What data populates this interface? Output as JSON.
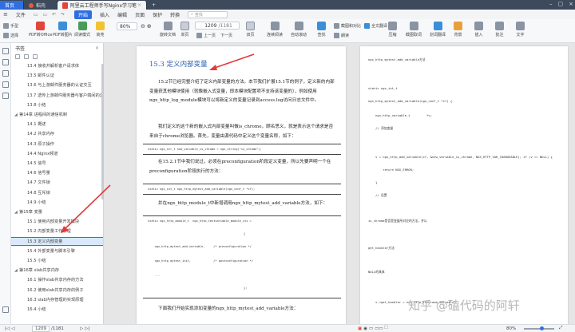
{
  "tabs": [
    {
      "label": "首页"
    },
    {
      "label": "稻壳"
    },
    {
      "label": "阿里云工程师手写Nginx学习笔记.pdf"
    }
  ],
  "menus": [
    "文件",
    "开始",
    "插入",
    "编辑",
    "页面",
    "保护",
    "转换",
    "查找"
  ],
  "toolbar": {
    "items": [
      "手型",
      "选择",
      "PDF转Office",
      "PDF转图片",
      "阅读模式",
      "高亮",
      "旋转文档",
      "单页",
      "双页",
      "连续阅读",
      "自动滚动",
      "查找",
      "截图和对比",
      "朗读",
      "全文翻译",
      "压缩",
      "截图取词",
      "划词翻译",
      "背景",
      "插入",
      "批注",
      "文字"
    ],
    "zoom": "80%",
    "page": "1209",
    "page_total": "/1181",
    "prev": "上一页",
    "next": "下一页"
  },
  "sidebar": {
    "title": "书签",
    "items": [
      {
        "label": "13.4 接收并解析客户请求体",
        "level": 2
      },
      {
        "label": "13.5 邮件认证",
        "level": 2
      },
      {
        "label": "13.6 与上游邮件服务器的认证交互",
        "level": 2
      },
      {
        "label": "13.7 透传上游邮件服务器与客户端间的流",
        "level": 2
      },
      {
        "label": "13.8 小结",
        "level": 2
      },
      {
        "label": "第14章 进程间的通信机制",
        "level": 1
      },
      {
        "label": "14.1 概述",
        "level": 2
      },
      {
        "label": "14.2 共享内存",
        "level": 2
      },
      {
        "label": "14.3 原子操作",
        "level": 2
      },
      {
        "label": "14.4 Nginx频道",
        "level": 2
      },
      {
        "label": "14.5 信号",
        "level": 2
      },
      {
        "label": "14.6 信号量",
        "level": 2
      },
      {
        "label": "14.7 文件锁",
        "level": 2
      },
      {
        "label": "14.8 互斥锁",
        "level": 2
      },
      {
        "label": "14.9 小结",
        "level": 2
      },
      {
        "label": "第15章 变量",
        "level": 1
      },
      {
        "label": "15.1 使用内部变量开发模块",
        "level": 2
      },
      {
        "label": "15.2 内部变量工作原理",
        "level": 2
      },
      {
        "label": "15.3 定义内部变量",
        "level": 2
      },
      {
        "label": "15.4 外部变量与脚本引擎",
        "level": 2
      },
      {
        "label": "15.5 小结",
        "level": 2
      },
      {
        "label": "第16章 slab共享内存",
        "level": 1
      },
      {
        "label": "16.1 操作slab共享内存的方法",
        "level": 2
      },
      {
        "label": "16.2 使用slab共享内存的例子",
        "level": 2
      },
      {
        "label": "16.3 slab内存管理的实现原理",
        "level": 2
      },
      {
        "label": "16.4 小结",
        "level": 2
      }
    ]
  },
  "doc": {
    "heading": "15.3   定义内部变量",
    "para1": "15.2节已经完整介绍了定义内部变量的方法。本节我们扩展15.1节的例子，定义新的内部变量获其他模块使用（就像嵌入式变量，即本模块配置项不支持该变量的），例如使用ngx_http_log_module模块可以将新定义的变量记录到access.log访问日志文件中。",
    "para2": "我们定义的这个新的嵌入式内部变量叫做is_chrome，顾名思义，就是表示这个请求是否来自于chrome浏览器。首先，变量由源代码中定义这个变量名称，如下：",
    "code1": [
      "static ngx_str_t new_variable_is_chrome = ngx_string(\"is_chrome\");"
    ],
    "para3": "在15.2.1节中我们说过，必须在preconfiguration阶段定义变量，所以先要声明一个在preconfiguration阶段执行的方法：",
    "code2": [
      "static ngx_int_t ngx_http_mytest_add_variable(ngx_conf_t *cf);"
    ],
    "para4": "并在ngx_http_module_t中新增调用ngx_http_mytest_add_variable方法，如下：",
    "code3": [
      "static ngx_http_module_t  ngx_http_testvariable_module_ctx =",
      "{",
      "    ngx_http_mytest_add_variable,     /* preconfiguration */",
      "    ngx_http_mytest_init,             /* postconfiguration */",
      "    ...",
      "};"
    ],
    "para5": "下面我们开始实现添加变量的ngx_http_mytest_add_variable方法：",
    "right_lines": [
      "ngx_http_mytest_add_variable方法",
      "static ngx_int_t",
      "ngx_http_mytest_add_variable(ngx_conf_t *cf) {",
      "    ngx_http_variable_t         *v;",
      "    // 添加变量",
      "    v = ngx_http_add_variable(cf, &new_variable_is_chrome, NGX_HTTP_VAR_CHANGEABLE); if (v == NULL) {",
      "        return NGX_ERROR;",
      "    }",
      "    // 设置",
      "is_chrome是否是变量所对应的方法，并以",
      "get_handler方法",
      "NULL的具体",
      "    v->get_handler = ngx_http_ischrome_variable;"
    ]
  },
  "status": {
    "page": "1209",
    "page_total": "/1181",
    "zoom": "80%"
  },
  "watermark": "知乎 @磕代码的阿轩"
}
